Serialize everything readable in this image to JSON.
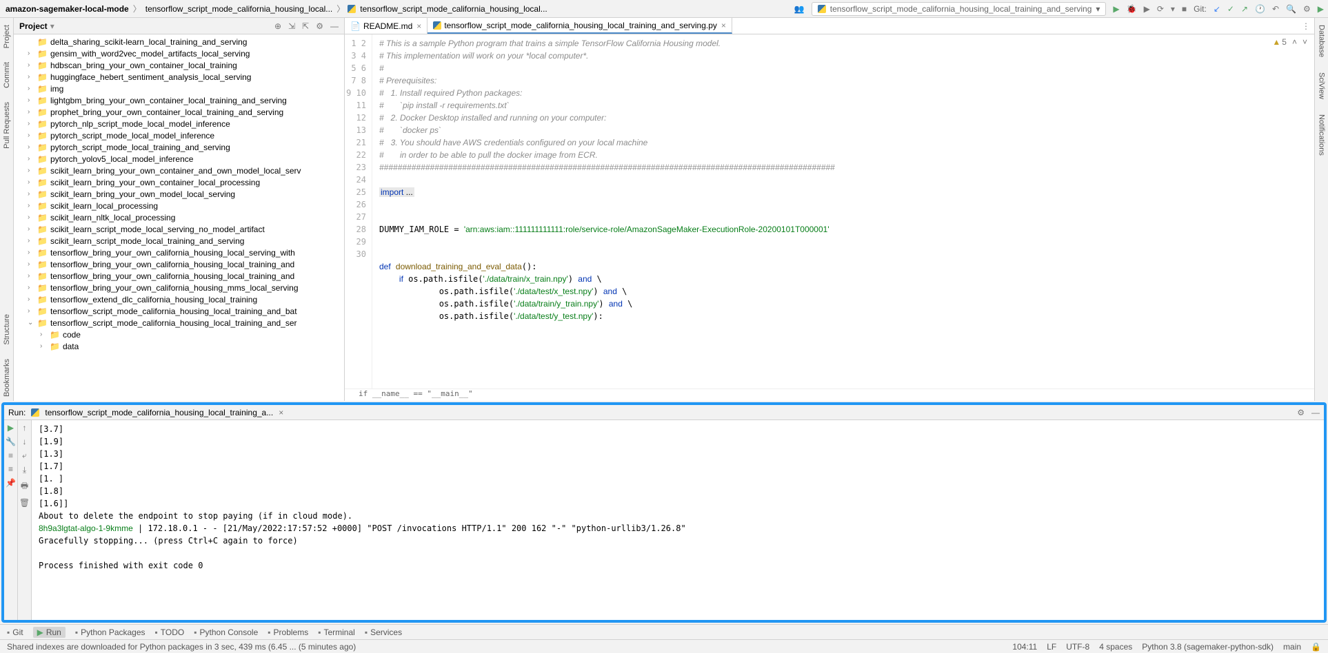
{
  "breadcrumbs": [
    "amazon-sagemaker-local-mode",
    "tensorflow_script_mode_california_housing_local...",
    "tensorflow_script_mode_california_housing_local..."
  ],
  "runConfig": "tensorflow_script_mode_california_housing_local_training_and_serving",
  "gitLabel": "Git:",
  "leftStrip": [
    "Project",
    "Commit",
    "Pull Requests",
    "Structure",
    "Bookmarks"
  ],
  "projectToolTitle": "Project",
  "tree": [
    {
      "n": "delta_sharing_scikit-learn_local_training_and_serving",
      "a": ""
    },
    {
      "n": "gensim_with_word2vec_model_artifacts_local_serving",
      "a": ">"
    },
    {
      "n": "hdbscan_bring_your_own_container_local_training",
      "a": ">"
    },
    {
      "n": "huggingface_hebert_sentiment_analysis_local_serving",
      "a": ">"
    },
    {
      "n": "img",
      "a": ">"
    },
    {
      "n": "lightgbm_bring_your_own_container_local_training_and_serving",
      "a": ">"
    },
    {
      "n": "prophet_bring_your_own_container_local_training_and_serving",
      "a": ">"
    },
    {
      "n": "pytorch_nlp_script_mode_local_model_inference",
      "a": ">"
    },
    {
      "n": "pytorch_script_mode_local_model_inference",
      "a": ">"
    },
    {
      "n": "pytorch_script_mode_local_training_and_serving",
      "a": ">"
    },
    {
      "n": "pytorch_yolov5_local_model_inference",
      "a": ">"
    },
    {
      "n": "scikit_learn_bring_your_own_container_and_own_model_local_serv",
      "a": ">"
    },
    {
      "n": "scikit_learn_bring_your_own_container_local_processing",
      "a": ">"
    },
    {
      "n": "scikit_learn_bring_your_own_model_local_serving",
      "a": ">"
    },
    {
      "n": "scikit_learn_local_processing",
      "a": ">"
    },
    {
      "n": "scikit_learn_nltk_local_processing",
      "a": ">"
    },
    {
      "n": "scikit_learn_script_mode_local_serving_no_model_artifact",
      "a": ">"
    },
    {
      "n": "scikit_learn_script_mode_local_training_and_serving",
      "a": ">"
    },
    {
      "n": "tensorflow_bring_your_own_california_housing_local_serving_with",
      "a": ">"
    },
    {
      "n": "tensorflow_bring_your_own_california_housing_local_training_and",
      "a": ">"
    },
    {
      "n": "tensorflow_bring_your_own_california_housing_local_training_and",
      "a": ">"
    },
    {
      "n": "tensorflow_bring_your_own_california_housing_mms_local_serving",
      "a": ">"
    },
    {
      "n": "tensorflow_extend_dlc_california_housing_local_training",
      "a": ">"
    },
    {
      "n": "tensorflow_script_mode_california_housing_local_training_and_bat",
      "a": ">"
    },
    {
      "n": "tensorflow_script_mode_california_housing_local_training_and_ser",
      "a": "v"
    },
    {
      "n": "code",
      "a": ">",
      "indent": 1
    },
    {
      "n": "data",
      "a": ">",
      "indent": 1
    }
  ],
  "tabs": [
    {
      "label": "README.md",
      "active": false,
      "icon": "md"
    },
    {
      "label": "tensorflow_script_mode_california_housing_local_training_and_serving.py",
      "active": true,
      "icon": "py"
    }
  ],
  "warnCount": "5",
  "code": {
    "lines": [
      {
        "n": 1,
        "t": "# This is a sample Python program that trains a simple TensorFlow California Housing model.",
        "c": "cm"
      },
      {
        "n": 2,
        "t": "# This implementation will work on your *local computer*.",
        "c": "cm"
      },
      {
        "n": 3,
        "t": "#",
        "c": "cm"
      },
      {
        "n": 4,
        "t": "# Prerequisites:",
        "c": "cm"
      },
      {
        "n": 5,
        "t": "#   1. Install required Python packages:",
        "c": "cm"
      },
      {
        "n": 6,
        "t": "#       `pip install -r requirements.txt`",
        "c": "cm"
      },
      {
        "n": 7,
        "t": "#   2. Docker Desktop installed and running on your computer:",
        "c": "cm"
      },
      {
        "n": 8,
        "t": "#       `docker ps`",
        "c": "cm"
      },
      {
        "n": 9,
        "t": "#   3. You should have AWS credentials configured on your local machine",
        "c": "cm"
      },
      {
        "n": 10,
        "t": "#       in order to be able to pull the docker image from ECR.",
        "c": "cm"
      },
      {
        "n": 11,
        "t": "###################################################################################################",
        "c": "cm"
      },
      {
        "n": 12,
        "t": "",
        "c": ""
      },
      {
        "n": 13,
        "html": "<span class='imp'><span class='kw'>import </span>...</span>"
      },
      {
        "n": 21,
        "t": "",
        "c": ""
      },
      {
        "n": 22,
        "t": "",
        "c": ""
      },
      {
        "n": 23,
        "html": "DUMMY_IAM_ROLE = <span class='st'>'arn:aws:iam::111111111111:role/service-role/AmazonSageMaker-ExecutionRole-20200101T000001'</span>"
      },
      {
        "n": 24,
        "t": "",
        "c": ""
      },
      {
        "n": 25,
        "t": "",
        "c": ""
      },
      {
        "n": 26,
        "html": "<span class='kw'>def</span> <span class='fn'>download_training_and_eval_data</span>():"
      },
      {
        "n": 27,
        "html": "    <span class='kw'>if</span> os.path.isfile(<span class='st'>'./data/train/x_train.npy'</span>) <span class='kw'>and</span> \\"
      },
      {
        "n": 28,
        "html": "            os.path.isfile(<span class='st'>'./data/test/x_test.npy'</span>) <span class='kw'>and</span> \\"
      },
      {
        "n": 29,
        "html": "            os.path.isfile(<span class='st'>'./data/train/y_train.npy'</span>) <span class='kw'>and</span> \\"
      },
      {
        "n": 30,
        "html": "            os.path.isfile(<span class='st'>'./data/test/y_test.npy'</span>):"
      }
    ],
    "breadcrumb": "if __name__ == \"__main__\""
  },
  "runTab": {
    "label": "Run:",
    "title": "tensorflow_script_mode_california_housing_local_training_a..."
  },
  "console": [
    {
      "t": "[3.7]"
    },
    {
      "t": "[1.9]"
    },
    {
      "t": "[1.3]"
    },
    {
      "t": "[1.7]"
    },
    {
      "t": "[1. ]"
    },
    {
      "t": "[1.8]"
    },
    {
      "t": "[1.6]]"
    },
    {
      "t": "About to delete the endpoint to stop paying (if in cloud mode)."
    },
    {
      "html": "<span class='cid'>8h9a3lgtat-algo-1-9kmme</span> | 172.18.0.1 - - [21/May/2022:17:57:52 +0000] \"POST /invocations HTTP/1.1\" 200 162 \"-\" \"python-urllib3/1.26.8\""
    },
    {
      "t": "Gracefully stopping... (press Ctrl+C again to force)"
    },
    {
      "t": ""
    },
    {
      "t": "Process finished with exit code 0"
    }
  ],
  "bottomTabs": [
    "Git",
    "Run",
    "Python Packages",
    "TODO",
    "Python Console",
    "Problems",
    "Terminal",
    "Services"
  ],
  "statusLeft": "Shared indexes are downloaded for Python packages in 3 sec, 439 ms (6.45 ... (5 minutes ago)",
  "statusRight": [
    "104:11",
    "LF",
    "UTF-8",
    "4 spaces",
    "Python 3.8 (sagemaker-python-sdk)",
    "main"
  ],
  "rightStrip": [
    "Database",
    "SciView",
    "Notifications"
  ]
}
